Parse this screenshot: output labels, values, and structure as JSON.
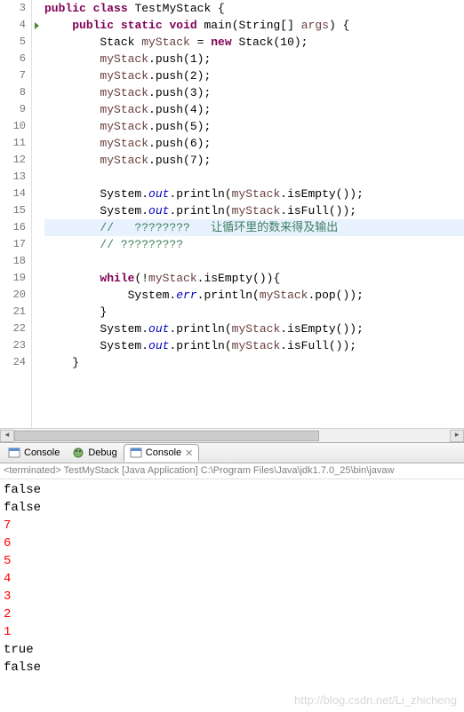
{
  "editor": {
    "startLine": 3,
    "highlightLine": 16,
    "runMarkerLine": 4,
    "lines": [
      {
        "n": 3,
        "indent": 0,
        "tokens": [
          {
            "t": "public",
            "c": "kw"
          },
          {
            "t": " "
          },
          {
            "t": "class",
            "c": "kw"
          },
          {
            "t": " TestMyStack {"
          }
        ]
      },
      {
        "n": 4,
        "indent": 1,
        "tokens": [
          {
            "t": "public",
            "c": "kw"
          },
          {
            "t": " "
          },
          {
            "t": "static",
            "c": "kw"
          },
          {
            "t": " "
          },
          {
            "t": "void",
            "c": "kw"
          },
          {
            "t": " main(String[] "
          },
          {
            "t": "args",
            "c": "var"
          },
          {
            "t": ") {"
          }
        ]
      },
      {
        "n": 5,
        "indent": 2,
        "tokens": [
          {
            "t": "Stack "
          },
          {
            "t": "myStack",
            "c": "var"
          },
          {
            "t": " = "
          },
          {
            "t": "new",
            "c": "kw"
          },
          {
            "t": " Stack(10);"
          }
        ]
      },
      {
        "n": 6,
        "indent": 2,
        "tokens": [
          {
            "t": "myStack",
            "c": "var"
          },
          {
            "t": ".push(1);"
          }
        ]
      },
      {
        "n": 7,
        "indent": 2,
        "tokens": [
          {
            "t": "myStack",
            "c": "var"
          },
          {
            "t": ".push(2);"
          }
        ]
      },
      {
        "n": 8,
        "indent": 2,
        "tokens": [
          {
            "t": "myStack",
            "c": "var"
          },
          {
            "t": ".push(3);"
          }
        ]
      },
      {
        "n": 9,
        "indent": 2,
        "tokens": [
          {
            "t": "myStack",
            "c": "var"
          },
          {
            "t": ".push(4);"
          }
        ]
      },
      {
        "n": 10,
        "indent": 2,
        "tokens": [
          {
            "t": "myStack",
            "c": "var"
          },
          {
            "t": ".push(5);"
          }
        ]
      },
      {
        "n": 11,
        "indent": 2,
        "tokens": [
          {
            "t": "myStack",
            "c": "var"
          },
          {
            "t": ".push(6);"
          }
        ]
      },
      {
        "n": 12,
        "indent": 2,
        "tokens": [
          {
            "t": "myStack",
            "c": "var"
          },
          {
            "t": ".push(7);"
          }
        ]
      },
      {
        "n": 13,
        "indent": 2,
        "tokens": []
      },
      {
        "n": 14,
        "indent": 2,
        "tokens": [
          {
            "t": "System."
          },
          {
            "t": "out",
            "c": "static-field"
          },
          {
            "t": ".println("
          },
          {
            "t": "myStack",
            "c": "var"
          },
          {
            "t": ".isEmpty());"
          }
        ]
      },
      {
        "n": 15,
        "indent": 2,
        "tokens": [
          {
            "t": "System."
          },
          {
            "t": "out",
            "c": "static-field"
          },
          {
            "t": ".println("
          },
          {
            "t": "myStack",
            "c": "var"
          },
          {
            "t": ".isFull());"
          }
        ]
      },
      {
        "n": 16,
        "indent": 2,
        "tokens": [
          {
            "t": "//   ????????   ",
            "c": "comment"
          },
          {
            "t": "让循环里的数来得及输出",
            "c": "cn-text"
          }
        ]
      },
      {
        "n": 17,
        "indent": 2,
        "tokens": [
          {
            "t": "// ?????????",
            "c": "comment"
          }
        ]
      },
      {
        "n": 18,
        "indent": 2,
        "tokens": []
      },
      {
        "n": 19,
        "indent": 2,
        "tokens": [
          {
            "t": "while",
            "c": "kw"
          },
          {
            "t": "(!"
          },
          {
            "t": "myStack",
            "c": "var"
          },
          {
            "t": ".isEmpty()){"
          }
        ]
      },
      {
        "n": 20,
        "indent": 3,
        "tokens": [
          {
            "t": "System."
          },
          {
            "t": "err",
            "c": "static-field"
          },
          {
            "t": ".println("
          },
          {
            "t": "myStack",
            "c": "var"
          },
          {
            "t": ".pop());"
          }
        ]
      },
      {
        "n": 21,
        "indent": 2,
        "tokens": [
          {
            "t": "}"
          }
        ]
      },
      {
        "n": 22,
        "indent": 2,
        "tokens": [
          {
            "t": "System."
          },
          {
            "t": "out",
            "c": "static-field"
          },
          {
            "t": ".println("
          },
          {
            "t": "myStack",
            "c": "var"
          },
          {
            "t": ".isEmpty());"
          }
        ]
      },
      {
        "n": 23,
        "indent": 2,
        "tokens": [
          {
            "t": "System."
          },
          {
            "t": "out",
            "c": "static-field"
          },
          {
            "t": ".println("
          },
          {
            "t": "myStack",
            "c": "var"
          },
          {
            "t": ".isFull());"
          }
        ]
      },
      {
        "n": 24,
        "indent": 1,
        "tokens": [
          {
            "t": "}"
          }
        ]
      }
    ]
  },
  "tabs": [
    {
      "label": "Console",
      "icon": "console-icon",
      "active": false
    },
    {
      "label": "Debug",
      "icon": "debug-icon",
      "active": false
    },
    {
      "label": "Console",
      "icon": "console-icon",
      "active": true
    }
  ],
  "console": {
    "header": "<terminated> TestMyStack [Java Application] C:\\Program Files\\Java\\jdk1.7.0_25\\bin\\javaw",
    "lines": [
      {
        "text": "false",
        "stream": "out"
      },
      {
        "text": "false",
        "stream": "out"
      },
      {
        "text": "7",
        "stream": "err"
      },
      {
        "text": "6",
        "stream": "err"
      },
      {
        "text": "5",
        "stream": "err"
      },
      {
        "text": "4",
        "stream": "err"
      },
      {
        "text": "3",
        "stream": "err"
      },
      {
        "text": "2",
        "stream": "err"
      },
      {
        "text": "1",
        "stream": "err"
      },
      {
        "text": "true",
        "stream": "out"
      },
      {
        "text": "false",
        "stream": "out"
      }
    ]
  },
  "watermark": "http://blog.csdn.net/Li_zhicheng"
}
